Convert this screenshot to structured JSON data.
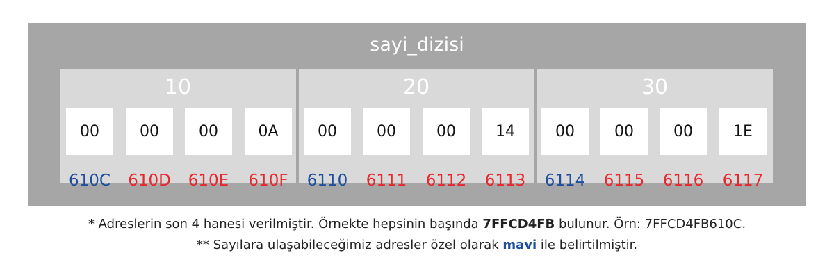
{
  "array_name": "sayi_dizisi",
  "elements": [
    {
      "value": "10",
      "bytes": [
        "00",
        "00",
        "00",
        "0A"
      ],
      "addresses": [
        "610C",
        "610D",
        "610E",
        "610F"
      ]
    },
    {
      "value": "20",
      "bytes": [
        "00",
        "00",
        "00",
        "14"
      ],
      "addresses": [
        "6110",
        "6111",
        "6112",
        "6113"
      ]
    },
    {
      "value": "30",
      "bytes": [
        "00",
        "00",
        "00",
        "1E"
      ],
      "addresses": [
        "6114",
        "6115",
        "6116",
        "6117"
      ]
    }
  ],
  "colors": {
    "panel": "#a6a6a6",
    "group": "#d9d9d9",
    "address_highlight": "#1f4e9e",
    "address_normal": "#e8262c"
  },
  "notes": {
    "line1_prefix": "* Adreslerin son 4 hanesi verilmiştir. Örnekte hepsinin başında ",
    "line1_bold": "7FFCD4FB",
    "line1_suffix": " bulunur. Örn: 7FFCD4FB610C.",
    "line2_prefix": "** Sayılara ulaşabileceğimiz adresler özel olarak ",
    "line2_highlight": "mavi",
    "line2_suffix": " ile belirtilmiştir."
  }
}
